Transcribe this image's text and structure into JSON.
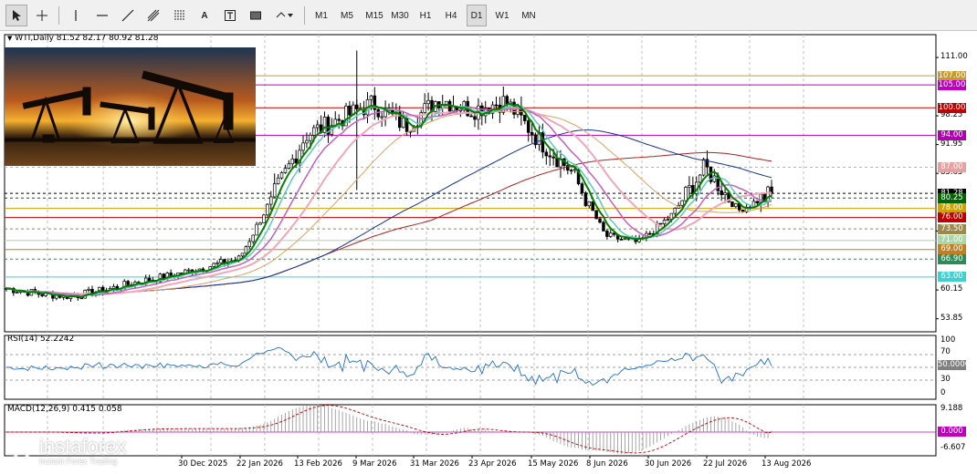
{
  "toolbar": {
    "tools": [
      {
        "name": "cursor-tool-icon"
      },
      {
        "name": "crosshair-tool-icon"
      },
      {
        "name": "vertical-line-tool-icon"
      },
      {
        "name": "horizontal-line-tool-icon"
      },
      {
        "name": "trend-line-tool-icon"
      },
      {
        "name": "channel-tool-icon"
      },
      {
        "name": "fibonacci-tool-icon"
      },
      {
        "name": "text-tool-label",
        "label": "A"
      },
      {
        "name": "text-box-tool-icon"
      },
      {
        "name": "rectangle-tool-icon"
      },
      {
        "name": "more-shapes-icon"
      }
    ],
    "timeframes": [
      "M1",
      "M5",
      "M15",
      "M30",
      "H1",
      "H4",
      "D1",
      "W1",
      "MN"
    ],
    "active_timeframe": "D1"
  },
  "chart": {
    "symbol_header": "WTI,Daily  81.52 82.17 80.92 81.28",
    "price_ticks": [
      "111.00",
      "98.25",
      "91.95",
      "85.65",
      "73.05",
      "60.15",
      "53.85"
    ],
    "level_labels": [
      {
        "text": "107.00",
        "bg": "#c79a2e",
        "fg": "#ffffff"
      },
      {
        "text": "105.00",
        "bg": "#c000c0",
        "fg": "#ffffff"
      },
      {
        "text": "100.00",
        "bg": "#c00000",
        "fg": "#ffffff"
      },
      {
        "text": "94.00",
        "bg": "#b000b0",
        "fg": "#ffffff"
      },
      {
        "text": "87.00",
        "bg": "#e8a0a0",
        "fg": "#ffffff"
      },
      {
        "text": "81.28",
        "bg": "#000000",
        "fg": "#ffffff"
      },
      {
        "text": "80.25",
        "bg": "#006400",
        "fg": "#ffffff"
      },
      {
        "text": "78.00",
        "bg": "#d4a000",
        "fg": "#ffffff"
      },
      {
        "text": "76.00",
        "bg": "#c00000",
        "fg": "#ffffff"
      },
      {
        "text": "73.50",
        "bg": "#9c8a4a",
        "fg": "#ffffff"
      },
      {
        "text": "71.00",
        "bg": "#a8d8a8",
        "fg": "#ffffff"
      },
      {
        "text": "69.00",
        "bg": "#c08020",
        "fg": "#ffffff"
      },
      {
        "text": "66.90",
        "bg": "#2e8b57",
        "fg": "#ffffff"
      },
      {
        "text": "63.00",
        "bg": "#40d0d0",
        "fg": "#ffffff"
      }
    ],
    "dates": [
      "30 Dec 2025",
      "22 Jan 2026",
      "13 Feb 2026",
      "9 Mar 2026",
      "31 Mar 2026",
      "23 Apr 2026",
      "15 May 2026",
      "8 Jun 2026",
      "30 Jun 2026",
      "22 Jul 2026",
      "13 Aug 2026"
    ]
  },
  "rsi": {
    "header": "RSI(14) 52.2242",
    "ticks": [
      "100",
      "70",
      "30",
      "0"
    ],
    "value_label": "50.0000"
  },
  "macd": {
    "header": "MACD(12,26,9) 0.415 0.058",
    "ticks": [
      "9.188",
      "-6.607"
    ],
    "value_label": "0.000"
  },
  "watermark": {
    "brand": "instaforex",
    "tagline": "Instant Forex Trading"
  },
  "colors": {
    "candle": "#000000",
    "ma_fast": "#008000",
    "ma_teal": "#5fc8b8",
    "ma_purple": "#c060c0",
    "ma_pink": "#f0a8b8",
    "ma_orange": "#e0a060",
    "ma_blue": "#1030a0",
    "ma_red": "#b02020",
    "rsi_line": "#1e6fd0",
    "macd_hist": "#909090",
    "macd_signal": "#c00000"
  },
  "chart_data": {
    "type": "candlestick",
    "title": "WTI,Daily",
    "ohlc_last": {
      "open": 81.52,
      "high": 82.17,
      "low": 80.92,
      "close": 81.28
    },
    "ylim": [
      51,
      116
    ],
    "x": [
      "2025-12-05",
      "2025-12-18",
      "2025-12-30",
      "2026-01-10",
      "2026-01-22",
      "2026-02-02",
      "2026-02-13",
      "2026-02-24",
      "2026-03-02",
      "2026-03-09",
      "2026-03-20",
      "2026-03-31",
      "2026-04-11",
      "2026-04-23",
      "2026-05-04",
      "2026-05-15",
      "2026-05-27",
      "2026-06-08",
      "2026-06-19",
      "2026-06-30",
      "2026-07-11",
      "2026-07-22",
      "2026-08-02",
      "2026-08-13"
    ],
    "close": [
      60.5,
      59.3,
      58.8,
      60.2,
      62.0,
      63.4,
      65.2,
      67.0,
      80.5,
      94.0,
      97.5,
      101.0,
      96.0,
      102.0,
      99.5,
      101.5,
      93.0,
      86.0,
      72.0,
      70.5,
      76.5,
      87.0,
      77.5,
      81.3
    ],
    "rsi_14_last": 52.2242,
    "macd_last": {
      "macd": 0.415,
      "signal": 0.058
    }
  }
}
